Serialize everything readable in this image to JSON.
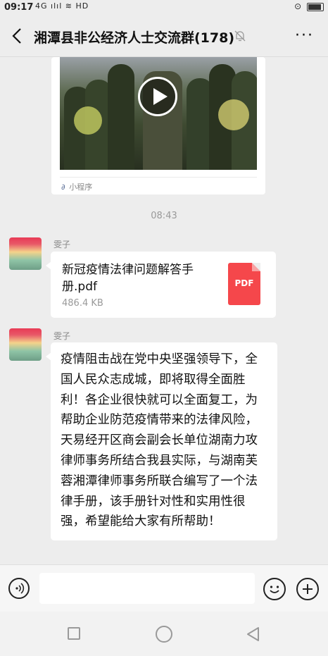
{
  "status_bar": {
    "time": "09:17",
    "signal": "4G ılıl ≋ HD"
  },
  "header": {
    "title": "湘潭县非公经济人士交流群(178)"
  },
  "mini_program_card": {
    "label": "小程序"
  },
  "timestamp": "08:43",
  "messages": [
    {
      "sender": "雯子",
      "type": "file",
      "file_name": "新冠疫情法律问题解答手册.pdf",
      "file_size": "486.4 KB",
      "file_icon_label": "PDF"
    },
    {
      "sender": "雯子",
      "type": "text",
      "text": "疫情阻击战在党中央坚强领导下，全国人民众志成城，即将取得全面胜利！各企业很快就可以全面复工，为帮助企业防范疫情带来的法律风险，天易经开区商会副会长单位湖南力攻律师事务所结合我县实际，与湖南芙蓉湘潭律师事务所联合编写了一个法律手册，该手册针对性和实用性很强，希望能给大家有所帮助！"
    }
  ],
  "colors": {
    "background": "#ededed",
    "bubble": "#ffffff",
    "pdf_red": "#f5474b",
    "link_blue": "#576b95"
  }
}
